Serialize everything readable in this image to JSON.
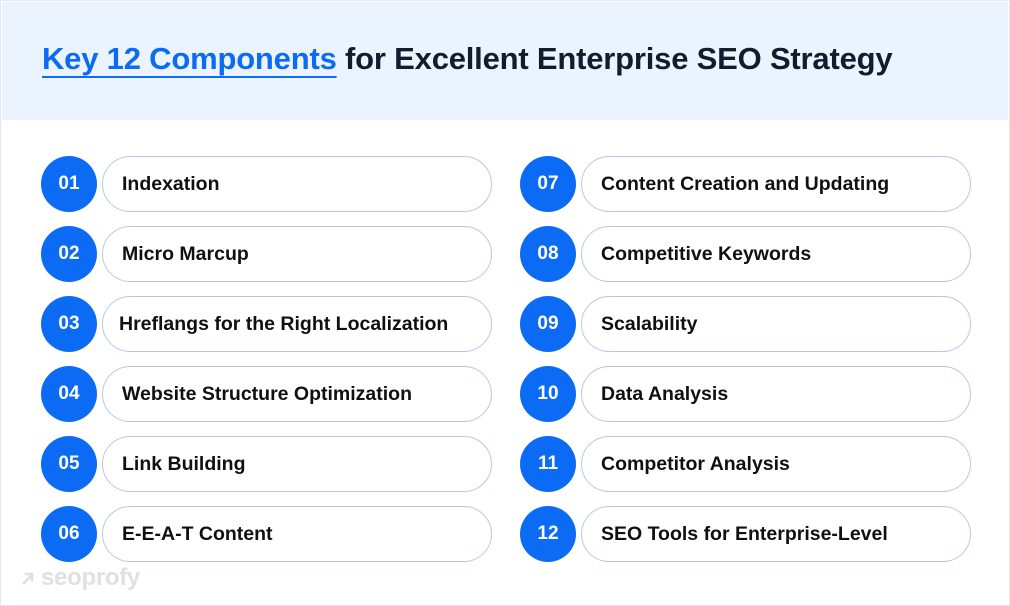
{
  "header": {
    "title_accent": "Key 12 Components",
    "title_rest": " for Excellent Enterprise SEO Strategy"
  },
  "components": [
    {
      "number": "01",
      "label": "Indexation"
    },
    {
      "number": "02",
      "label": "Micro Marcup"
    },
    {
      "number": "03",
      "label": "Hreflangs for the Right Localization"
    },
    {
      "number": "04",
      "label": "Website Structure Optimization"
    },
    {
      "number": "05",
      "label": "Link Building"
    },
    {
      "number": "06",
      "label": "E-E-A-T Content"
    },
    {
      "number": "07",
      "label": "Content Creation and Updating"
    },
    {
      "number": "08",
      "label": "Competitive Keywords"
    },
    {
      "number": "09",
      "label": "Scalability"
    },
    {
      "number": "10",
      "label": "Data Analysis"
    },
    {
      "number": "11",
      "label": "Competitor Analysis"
    },
    {
      "number": "12",
      "label": "SEO Tools for Enterprise-Level"
    }
  ],
  "brand": {
    "logo_text": "seoprofy",
    "logo_icon": "arrow-up-right-icon"
  },
  "colors": {
    "accent": "#0b6bf4",
    "header_bg": "#ebf4fe",
    "pill_border": "#b7c8e3",
    "text": "#101010"
  }
}
